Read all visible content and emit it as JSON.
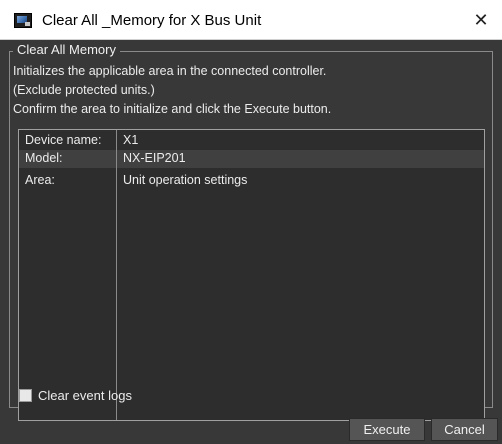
{
  "window": {
    "title": "Clear All _Memory for X Bus Unit",
    "close_glyph": "✕"
  },
  "group": {
    "label": "Clear All Memory",
    "description": [
      "Initializes the applicable area in the connected controller.",
      "(Exclude protected units.)",
      "Confirm the area to initialize and click the Execute button."
    ]
  },
  "info": {
    "rows": [
      {
        "label": "Device name:",
        "value": "X1"
      },
      {
        "label": "Model:",
        "value": "NX-EIP201"
      },
      {
        "label": "Area:",
        "value": "Unit operation settings"
      }
    ]
  },
  "options": {
    "clear_event_logs_label": "Clear event logs",
    "clear_event_logs_checked": false
  },
  "buttons": {
    "execute": "Execute",
    "cancel": "Cancel"
  },
  "icons": {
    "app": "app-window-icon",
    "close": "close-icon"
  },
  "colors": {
    "dialog_background": "#383838",
    "info_background": "#2d2d2d",
    "text": "#ececec"
  }
}
